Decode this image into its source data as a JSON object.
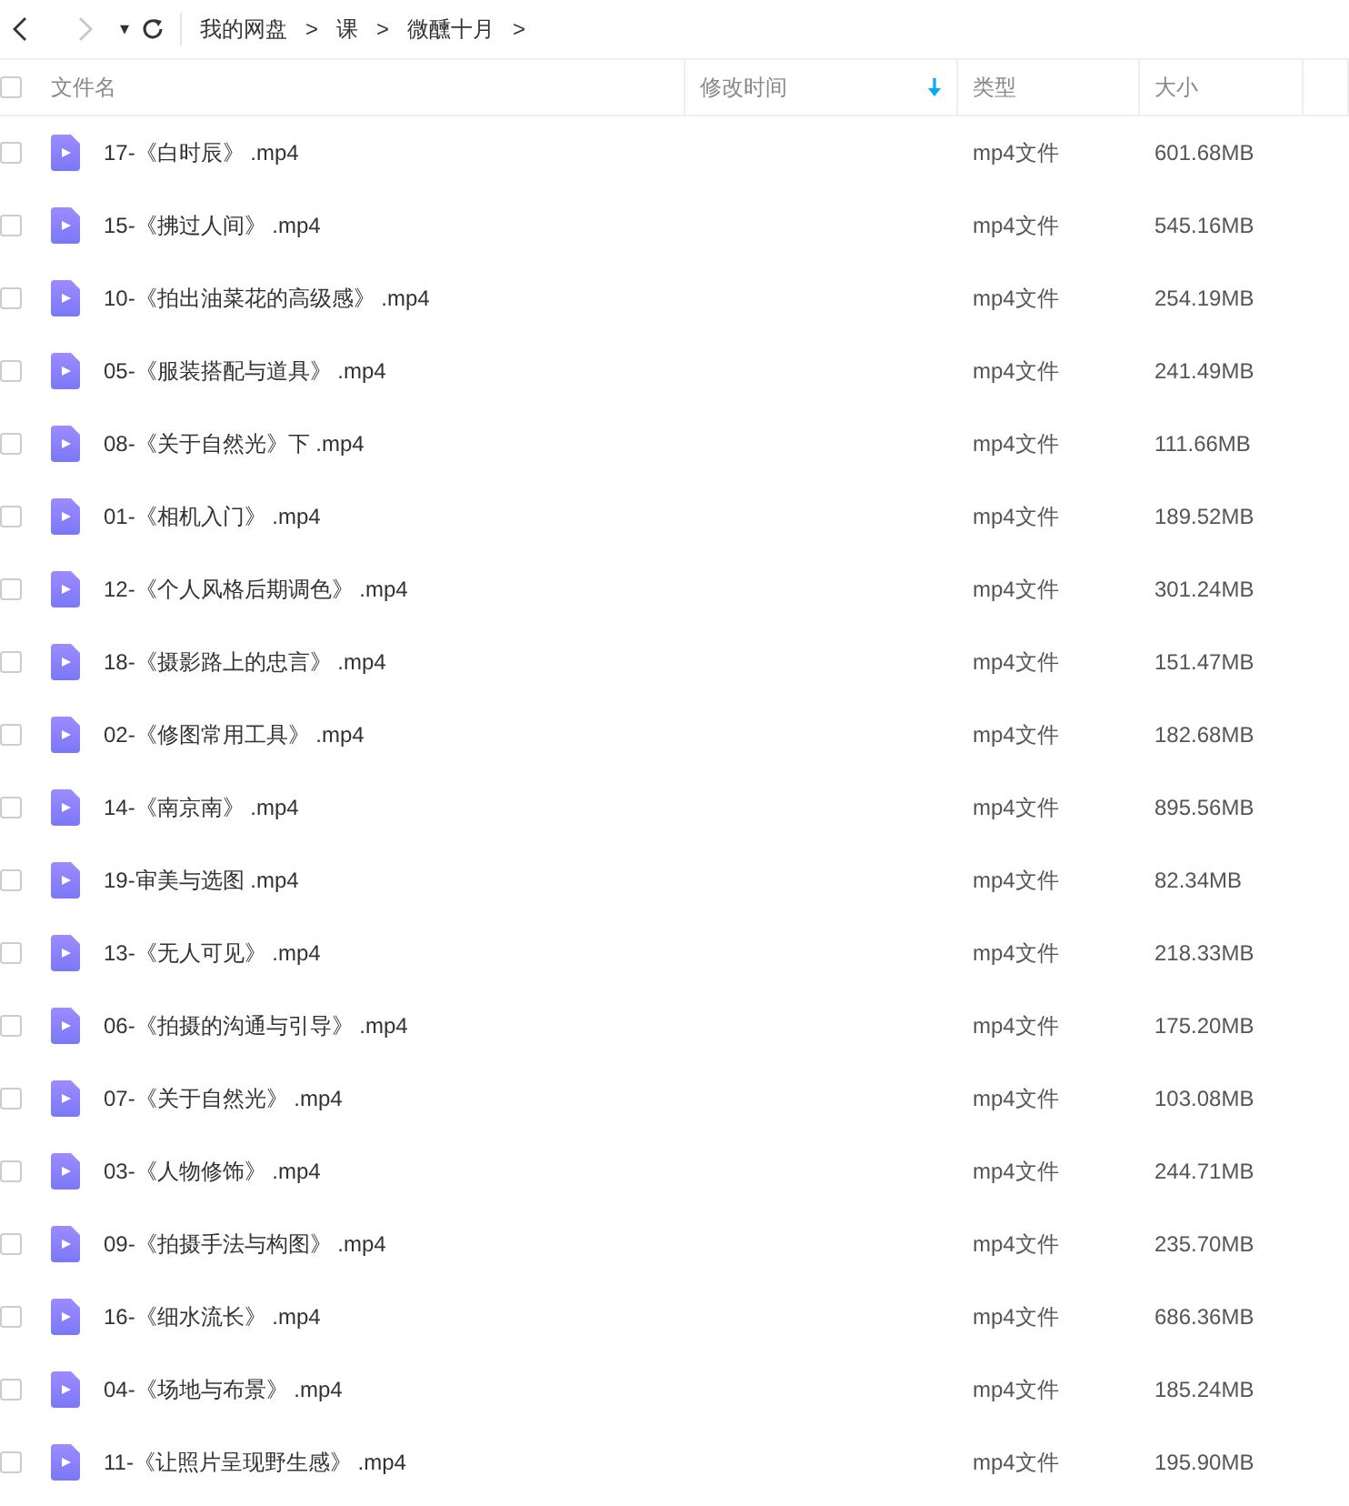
{
  "toolbar": {
    "back_enabled": true,
    "forward_enabled": false,
    "dropdown": "▾"
  },
  "breadcrumb": [
    "我的网盘",
    "课",
    "微醺十月"
  ],
  "breadcrumb_separator": ">",
  "all_checked": false,
  "columns": [
    {
      "label": "文件名",
      "sorted": false
    },
    {
      "label": "修改时间",
      "sorted": true
    },
    {
      "label": "类型",
      "sorted": false
    },
    {
      "label": "大小",
      "sorted": false
    }
  ],
  "rows": [
    {
      "name": "17-《白时辰》 .mp4",
      "type": "mp4文件",
      "size": "601.68MB",
      "checked": false
    },
    {
      "name": "15-《拂过人间》 .mp4",
      "type": "mp4文件",
      "size": "545.16MB",
      "checked": false
    },
    {
      "name": "10-《拍出油菜花的高级感》 .mp4",
      "type": "mp4文件",
      "size": "254.19MB",
      "checked": false
    },
    {
      "name": "05-《服装搭配与道具》 .mp4",
      "type": "mp4文件",
      "size": "241.49MB",
      "checked": false
    },
    {
      "name": "08-《关于自然光》下 .mp4",
      "type": "mp4文件",
      "size": "111.66MB",
      "checked": false
    },
    {
      "name": "01-《相机入门》 .mp4",
      "type": "mp4文件",
      "size": "189.52MB",
      "checked": false
    },
    {
      "name": "12-《个人风格后期调色》 .mp4",
      "type": "mp4文件",
      "size": "301.24MB",
      "checked": false
    },
    {
      "name": "18-《摄影路上的忠言》 .mp4",
      "type": "mp4文件",
      "size": "151.47MB",
      "checked": false
    },
    {
      "name": "02-《修图常用工具》 .mp4",
      "type": "mp4文件",
      "size": "182.68MB",
      "checked": false
    },
    {
      "name": "14-《南京南》 .mp4",
      "type": "mp4文件",
      "size": "895.56MB",
      "checked": false
    },
    {
      "name": "19-审美与选图 .mp4",
      "type": "mp4文件",
      "size": "82.34MB",
      "checked": false
    },
    {
      "name": "13-《无人可见》 .mp4",
      "type": "mp4文件",
      "size": "218.33MB",
      "checked": false
    },
    {
      "name": "06-《拍摄的沟通与引导》 .mp4",
      "type": "mp4文件",
      "size": "175.20MB",
      "checked": false
    },
    {
      "name": "07-《关于自然光》 .mp4",
      "type": "mp4文件",
      "size": "103.08MB",
      "checked": false
    },
    {
      "name": "03-《人物修饰》 .mp4",
      "type": "mp4文件",
      "size": "244.71MB",
      "checked": false
    },
    {
      "name": "09-《拍摄手法与构图》 .mp4",
      "type": "mp4文件",
      "size": "235.70MB",
      "checked": false
    },
    {
      "name": "16-《细水流长》 .mp4",
      "type": "mp4文件",
      "size": "686.36MB",
      "checked": false
    },
    {
      "name": "04-《场地与布景》 .mp4",
      "type": "mp4文件",
      "size": "185.24MB",
      "checked": false
    },
    {
      "name": "11-《让照片呈现野生感》 .mp4",
      "type": "mp4文件",
      "size": "195.90MB",
      "checked": false
    }
  ]
}
